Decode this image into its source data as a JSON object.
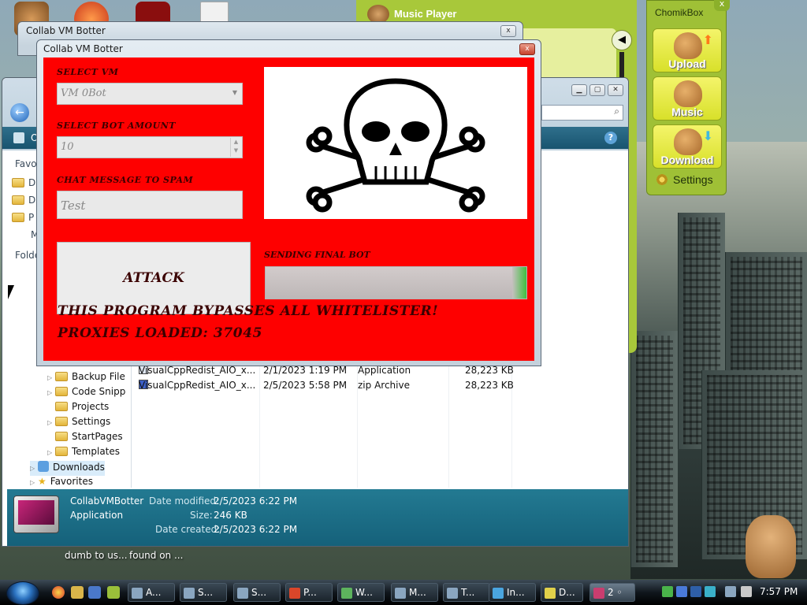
{
  "desktop": {
    "caption_left": "dumb to us...",
    "caption_right": "found on ..."
  },
  "music_player": {
    "title": "Music Player"
  },
  "chomikbox": {
    "title": "ChomikBox",
    "close": "x",
    "buttons": [
      {
        "label": "Upload"
      },
      {
        "label": "Music"
      },
      {
        "label": "Download"
      }
    ],
    "settings": "Settings"
  },
  "botter_back": {
    "title": "Collab VM Botter",
    "close": "x"
  },
  "botter": {
    "title": "Collab VM Botter",
    "close": "x",
    "select_vm_label": "SELECT VM",
    "select_vm_value": "VM 0Bot",
    "bot_amount_label": "SELECT BOT AMOUNT",
    "bot_amount_value": "10",
    "chat_label": "CHAT MESSAGE TO SPAM",
    "chat_value": "Test",
    "attack_label": "ATTACK",
    "sending_label": "SENDING FINAL BOT",
    "progress": 0.97,
    "bypass_text": "THIS PROGRAM BYPASSES ALL WHITELISTER!",
    "proxies_text": "PROXIES LOADED: 37045",
    "colors": {
      "background": "#fe0000",
      "text": "#3a0000"
    }
  },
  "explorer": {
    "left_labels": {
      "favorites": "Favo",
      "folders": "Folde"
    },
    "fav_items": [
      "D",
      "D",
      "P",
      "M"
    ],
    "tree": [
      {
        "label": "Backup File"
      },
      {
        "label": "Code Snipp"
      },
      {
        "label": "Projects"
      },
      {
        "label": "Settings"
      },
      {
        "label": "StartPages"
      },
      {
        "label": "Templates"
      },
      {
        "label": "Downloads"
      },
      {
        "label": "Favorites"
      }
    ],
    "files": [
      {
        "name": "VisualCppRedist_AIO_x...",
        "date": "2/1/2023 1:19 PM",
        "type": "Application",
        "size": "28,223 KB"
      },
      {
        "name": "VisualCppRedist_AIO_x...",
        "date": "2/5/2023 5:58 PM",
        "type": "zip Archive",
        "size": "28,223 KB"
      }
    ],
    "details": {
      "name": "CollabVMBotter",
      "kind": "Application",
      "modified_label": "Date modified:",
      "modified_value": "2/5/2023 6:22 PM",
      "size_label": "Size:",
      "size_value": "246 KB",
      "created_label": "Date created:",
      "created_value": "2/5/2023 6:22 PM"
    },
    "nav_cmdbar_first": "O"
  },
  "taskbar": {
    "buttons": [
      {
        "label": "A..."
      },
      {
        "label": "S..."
      },
      {
        "label": "S..."
      },
      {
        "label": "P..."
      },
      {
        "label": "W..."
      },
      {
        "label": "M..."
      },
      {
        "label": "T..."
      },
      {
        "label": "In..."
      },
      {
        "label": "D..."
      },
      {
        "label": "2 ◦"
      }
    ],
    "clock": "7:57 PM"
  }
}
